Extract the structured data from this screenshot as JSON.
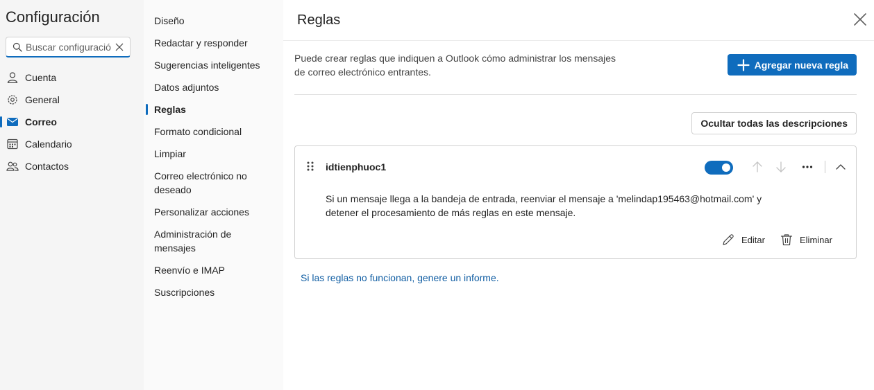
{
  "app": {
    "title": "Configuración"
  },
  "search": {
    "placeholder": "Buscar configuració"
  },
  "nav": {
    "items": [
      {
        "label": "Cuenta",
        "icon": "person-icon"
      },
      {
        "label": "General",
        "icon": "gear-icon"
      },
      {
        "label": "Correo",
        "icon": "mail-icon",
        "selected": true
      },
      {
        "label": "Calendario",
        "icon": "calendar-icon"
      },
      {
        "label": "Contactos",
        "icon": "people-icon"
      }
    ]
  },
  "subnav": {
    "items": [
      {
        "label": "Diseño"
      },
      {
        "label": "Redactar y responder"
      },
      {
        "label": "Sugerencias inteligentes"
      },
      {
        "label": "Datos adjuntos"
      },
      {
        "label": "Reglas",
        "selected": true
      },
      {
        "label": "Formato condicional"
      },
      {
        "label": "Limpiar"
      },
      {
        "label": "Correo electrónico no deseado"
      },
      {
        "label": "Personalizar acciones"
      },
      {
        "label": "Administración de mensajes"
      },
      {
        "label": "Reenvío e IMAP"
      },
      {
        "label": "Suscripciones"
      }
    ]
  },
  "main": {
    "title": "Reglas",
    "description": "Puede crear reglas que indiquen a Outlook cómo administrar los mensajes de correo electrónico entrantes.",
    "add_rule_label": "Agregar nueva regla",
    "hide_descriptions_label": "Ocultar todas las descripciones",
    "rule": {
      "name": "idtienphuoc1",
      "enabled": true,
      "description": "Si un mensaje llega a la bandeja de entrada, reenviar el mensaje a 'melindap195463@hotmail.com' y detener el procesamiento de más reglas en este mensaje.",
      "edit_label": "Editar",
      "delete_label": "Eliminar"
    },
    "report_link": "Si las reglas no funcionan, genere un informe."
  },
  "colors": {
    "accent": "#0f6cbd",
    "link": "#115ea3",
    "nav_bg": "#f5f5f5",
    "subnav_bg": "#fafafa"
  }
}
